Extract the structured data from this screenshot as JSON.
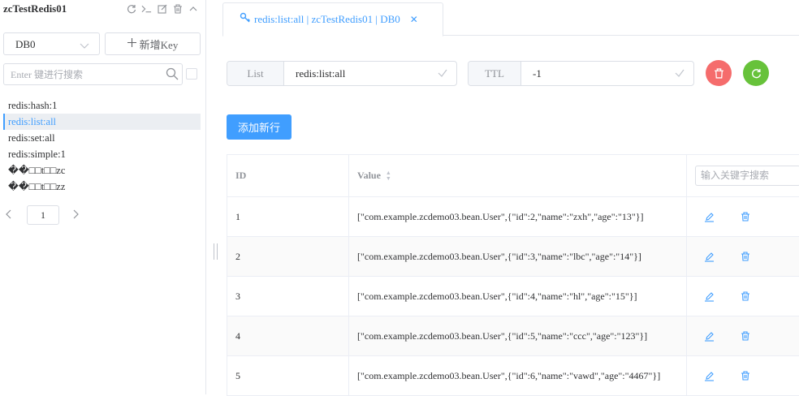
{
  "connection": {
    "title": "zcTestRedis01",
    "icons": [
      "refresh-icon",
      "terminal-icon",
      "edit-icon",
      "delete-icon",
      "collapse-icon"
    ]
  },
  "db_select": {
    "value": "DB0"
  },
  "new_key_button": {
    "label": "新增Key"
  },
  "key_search": {
    "placeholder": "Enter 键进行搜索"
  },
  "keys": [
    {
      "name": "redis:hash:1",
      "active": false
    },
    {
      "name": "redis:list:all",
      "active": true
    },
    {
      "name": "redis:set:all",
      "active": false
    },
    {
      "name": "redis:simple:1",
      "active": false
    },
    {
      "name": "��□□t□□zc",
      "active": false
    },
    {
      "name": "��□□t□□zz",
      "active": false
    }
  ],
  "pager": {
    "page": "1"
  },
  "tab": {
    "label": "redis:list:all | zcTestRedis01 | DB0"
  },
  "type_field": {
    "label": "List",
    "value": "redis:list:all"
  },
  "ttl_field": {
    "label": "TTL",
    "value": "-1"
  },
  "add_row_button": {
    "label": "添加新行"
  },
  "table": {
    "headers": {
      "id": "ID",
      "value": "Value"
    },
    "search_placeholder": "输入关键字搜索",
    "rows": [
      {
        "id": "1",
        "value": "[\"com.example.zcdemo03.bean.User\",{\"id\":2,\"name\":\"zxh\",\"age\":\"13\"}]"
      },
      {
        "id": "2",
        "value": "[\"com.example.zcdemo03.bean.User\",{\"id\":3,\"name\":\"lbc\",\"age\":\"14\"}]"
      },
      {
        "id": "3",
        "value": "[\"com.example.zcdemo03.bean.User\",{\"id\":4,\"name\":\"hl\",\"age\":\"15\"}]"
      },
      {
        "id": "4",
        "value": "[\"com.example.zcdemo03.bean.User\",{\"id\":5,\"name\":\"ccc\",\"age\":\"123\"}]"
      },
      {
        "id": "5",
        "value": "[\"com.example.zcdemo03.bean.User\",{\"id\":6,\"name\":\"vawd\",\"age\":\"4467\"}]"
      }
    ]
  },
  "colors": {
    "primary": "#409eff",
    "danger": "#f56c6c",
    "success": "#67c23a"
  }
}
